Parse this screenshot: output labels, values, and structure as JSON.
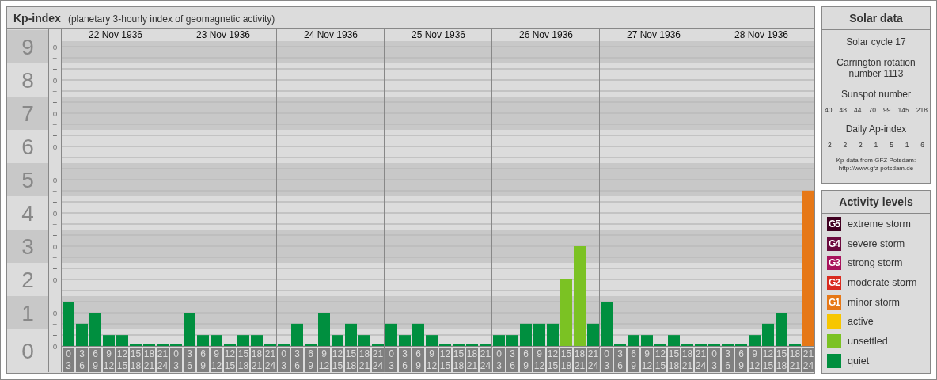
{
  "kp_panel": {
    "title": "Kp-index",
    "subtitle": "(planetary 3-hourly index of geomagnetic activity)",
    "minor_ticks": [
      "o",
      "−",
      "+",
      "o",
      "−",
      "+",
      "o",
      "−",
      "+",
      "o",
      "−",
      "+",
      "o",
      "−",
      "+",
      "o",
      "−",
      "+",
      "o",
      "−",
      "+",
      "o",
      "−",
      "+",
      "o",
      "−",
      "+",
      "o"
    ],
    "days": [
      {
        "date": "22 Nov 1936",
        "hours": [
          [
            "0",
            "3"
          ],
          [
            "3",
            "6"
          ],
          [
            "6",
            "9"
          ],
          [
            "9",
            "12"
          ],
          [
            "12",
            "15"
          ],
          [
            "15",
            "18"
          ],
          [
            "18",
            "21"
          ],
          [
            "21",
            "24"
          ]
        ]
      },
      {
        "date": "23 Nov 1936",
        "hours": [
          [
            "0",
            "3"
          ],
          [
            "3",
            "6"
          ],
          [
            "6",
            "9"
          ],
          [
            "9",
            "12"
          ],
          [
            "12",
            "15"
          ],
          [
            "15",
            "18"
          ],
          [
            "18",
            "21"
          ],
          [
            "21",
            "24"
          ]
        ]
      },
      {
        "date": "24 Nov 1936",
        "hours": [
          [
            "0",
            "3"
          ],
          [
            "3",
            "6"
          ],
          [
            "6",
            "9"
          ],
          [
            "9",
            "12"
          ],
          [
            "12",
            "15"
          ],
          [
            "15",
            "18"
          ],
          [
            "18",
            "21"
          ],
          [
            "21",
            "24"
          ]
        ]
      },
      {
        "date": "25 Nov 1936",
        "hours": [
          [
            "0",
            "3"
          ],
          [
            "3",
            "6"
          ],
          [
            "6",
            "9"
          ],
          [
            "9",
            "12"
          ],
          [
            "12",
            "15"
          ],
          [
            "15",
            "18"
          ],
          [
            "18",
            "21"
          ],
          [
            "21",
            "24"
          ]
        ]
      },
      {
        "date": "26 Nov 1936",
        "hours": [
          [
            "0",
            "3"
          ],
          [
            "3",
            "6"
          ],
          [
            "6",
            "9"
          ],
          [
            "9",
            "12"
          ],
          [
            "12",
            "15"
          ],
          [
            "15",
            "18"
          ],
          [
            "18",
            "21"
          ],
          [
            "21",
            "24"
          ]
        ]
      },
      {
        "date": "27 Nov 1936",
        "hours": [
          [
            "0",
            "3"
          ],
          [
            "3",
            "6"
          ],
          [
            "6",
            "9"
          ],
          [
            "9",
            "12"
          ],
          [
            "12",
            "15"
          ],
          [
            "15",
            "18"
          ],
          [
            "18",
            "21"
          ],
          [
            "21",
            "24"
          ]
        ]
      },
      {
        "date": "28 Nov 1936",
        "hours": [
          [
            "0",
            "3"
          ],
          [
            "3",
            "6"
          ],
          [
            "6",
            "9"
          ],
          [
            "9",
            "12"
          ],
          [
            "12",
            "15"
          ],
          [
            "15",
            "18"
          ],
          [
            "18",
            "21"
          ],
          [
            "21",
            "24"
          ]
        ]
      }
    ],
    "chart_data": {
      "type": "bar",
      "grid": true,
      "ylim": [
        0,
        9.5
      ],
      "yticks": [
        9,
        8,
        7,
        6,
        5,
        4,
        3,
        2,
        1,
        0
      ],
      "series": [
        {
          "color": "#008f3f",
          "values": [
            1.33,
            0.67,
            1,
            0.33,
            0.33,
            0,
            0,
            0,
            0,
            1,
            0.33,
            0.33,
            0,
            0.33,
            0.33,
            0,
            0,
            0.67,
            0,
            1,
            0.33,
            0.67,
            0.33,
            0,
            0.67,
            0.33,
            0.67,
            0.33,
            0,
            0,
            0,
            0,
            0.33,
            0.33,
            0.67,
            0.67,
            0.67,
            null,
            null,
            0.67,
            1.33,
            0,
            0.33,
            0.33,
            0,
            0.33,
            0,
            0,
            0,
            0,
            0,
            0.33,
            0.67,
            1,
            0,
            null
          ]
        },
        {
          "color": "#7bc223",
          "values": [
            null,
            null,
            null,
            null,
            null,
            null,
            null,
            null,
            null,
            null,
            null,
            null,
            null,
            null,
            null,
            null,
            null,
            null,
            null,
            null,
            null,
            null,
            null,
            null,
            null,
            null,
            null,
            null,
            null,
            null,
            null,
            null,
            null,
            null,
            null,
            null,
            null,
            2,
            3,
            null,
            null,
            null,
            null,
            null,
            null,
            null,
            null,
            null,
            null,
            null,
            null,
            null,
            null,
            null,
            null,
            null
          ]
        },
        {
          "color": "#e67817",
          "values": [
            null,
            null,
            null,
            null,
            null,
            null,
            null,
            null,
            null,
            null,
            null,
            null,
            null,
            null,
            null,
            null,
            null,
            null,
            null,
            null,
            null,
            null,
            null,
            null,
            null,
            null,
            null,
            null,
            null,
            null,
            null,
            null,
            null,
            null,
            null,
            null,
            null,
            null,
            null,
            null,
            null,
            null,
            null,
            null,
            null,
            null,
            null,
            null,
            null,
            null,
            null,
            null,
            null,
            null,
            null,
            4.67
          ]
        }
      ]
    }
  },
  "solar_data": {
    "title": "Solar data",
    "cycle": "Solar cycle 17",
    "rotation": "Carrington rotation number 1113",
    "sunspot_label": "Sunspot number",
    "sunspot_numbers": [
      "40",
      "48",
      "44",
      "70",
      "99",
      "145",
      "218"
    ],
    "ap_label": "Daily Ap-index",
    "ap_values": [
      "2",
      "2",
      "2",
      "1",
      "5",
      "1",
      "6"
    ],
    "credit": "Kp-data from GFZ Potsdam:",
    "credit_url": "http://www.gfz-potsdam.de"
  },
  "activity_levels": {
    "title": "Activity levels",
    "items": [
      {
        "badge": "G5",
        "label": "extreme storm",
        "color": "#3f0020"
      },
      {
        "badge": "G4",
        "label": "severe storm",
        "color": "#6b0a3e"
      },
      {
        "badge": "G3",
        "label": "strong storm",
        "color": "#a8135c"
      },
      {
        "badge": "G2",
        "label": "moderate storm",
        "color": "#d92b1f"
      },
      {
        "badge": "G1",
        "label": "minor storm",
        "color": "#e67817"
      },
      {
        "label": "active",
        "color": "#f7c600"
      },
      {
        "label": "unsettled",
        "color": "#7bc223"
      },
      {
        "label": "quiet",
        "color": "#008f3f"
      }
    ]
  }
}
